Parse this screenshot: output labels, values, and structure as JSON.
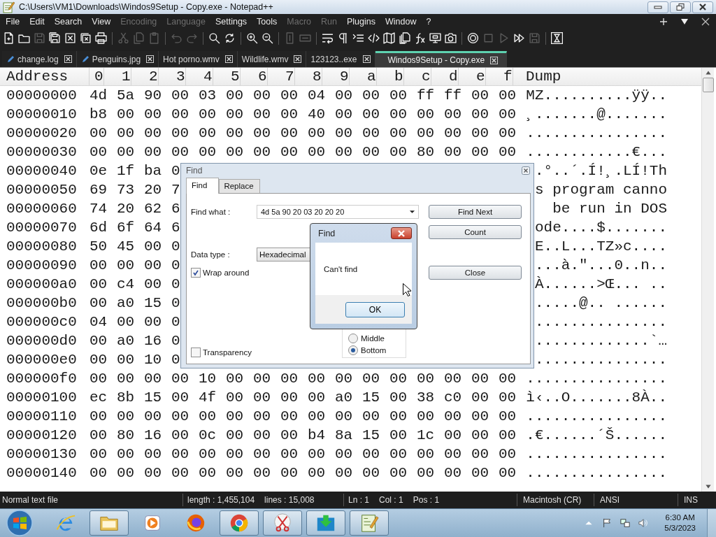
{
  "window": {
    "title": "C:\\Users\\VM1\\Downloads\\Windos9Setup - Copy.exe - Notepad++"
  },
  "menu": [
    {
      "label": "File",
      "disabled": false
    },
    {
      "label": "Edit",
      "disabled": false
    },
    {
      "label": "Search",
      "disabled": false
    },
    {
      "label": "View",
      "disabled": false
    },
    {
      "label": "Encoding",
      "disabled": true
    },
    {
      "label": "Language",
      "disabled": true
    },
    {
      "label": "Settings",
      "disabled": false
    },
    {
      "label": "Tools",
      "disabled": false
    },
    {
      "label": "Macro",
      "disabled": true
    },
    {
      "label": "Run",
      "disabled": true
    },
    {
      "label": "Plugins",
      "disabled": false
    },
    {
      "label": "Window",
      "disabled": false
    },
    {
      "label": "?",
      "disabled": false
    }
  ],
  "toolbar": [
    {
      "kind": "new",
      "disabled": false
    },
    {
      "kind": "open",
      "disabled": false
    },
    {
      "kind": "save",
      "disabled": true
    },
    {
      "kind": "saveall",
      "disabled": false
    },
    {
      "kind": "close",
      "disabled": false
    },
    {
      "kind": "closeall",
      "disabled": false
    },
    {
      "kind": "print",
      "disabled": false
    },
    {
      "kind": "separator"
    },
    {
      "kind": "cut",
      "disabled": true
    },
    {
      "kind": "copy",
      "disabled": true
    },
    {
      "kind": "paste",
      "disabled": true
    },
    {
      "kind": "separator"
    },
    {
      "kind": "undo",
      "disabled": true
    },
    {
      "kind": "redo",
      "disabled": true
    },
    {
      "kind": "separator"
    },
    {
      "kind": "find",
      "disabled": false
    },
    {
      "kind": "replace",
      "disabled": false
    },
    {
      "kind": "separator"
    },
    {
      "kind": "zoomin",
      "disabled": false
    },
    {
      "kind": "zoomout",
      "disabled": false
    },
    {
      "kind": "separator"
    },
    {
      "kind": "syncv",
      "disabled": true
    },
    {
      "kind": "synch",
      "disabled": true
    },
    {
      "kind": "separator"
    },
    {
      "kind": "wrap",
      "disabled": false
    },
    {
      "kind": "allchars",
      "disabled": false
    },
    {
      "kind": "indent",
      "disabled": false
    },
    {
      "kind": "code",
      "disabled": false
    },
    {
      "kind": "map",
      "disabled": false
    },
    {
      "kind": "docs",
      "disabled": false
    },
    {
      "kind": "fx",
      "disabled": false
    },
    {
      "kind": "monitor",
      "disabled": false
    },
    {
      "kind": "snapshot",
      "disabled": false
    },
    {
      "kind": "separator"
    },
    {
      "kind": "record",
      "disabled": false
    },
    {
      "kind": "stop",
      "disabled": true
    },
    {
      "kind": "play",
      "disabled": true
    },
    {
      "kind": "playmulti",
      "disabled": false
    },
    {
      "kind": "saverec",
      "disabled": true
    },
    {
      "kind": "separator"
    },
    {
      "kind": "macro",
      "disabled": false
    }
  ],
  "tabs": [
    {
      "label": "change.log",
      "selected": false,
      "modified": true
    },
    {
      "label": "Penguins.jpg",
      "selected": false,
      "modified": true
    },
    {
      "label": "Hot porno.wmv",
      "selected": false,
      "modified": false
    },
    {
      "label": "Wildlife.wmv",
      "selected": false,
      "modified": false
    },
    {
      "label": "123123..exe",
      "selected": false,
      "modified": false
    },
    {
      "label": "Windos9Setup - Copy.exe",
      "selected": true,
      "modified": false
    }
  ],
  "hex": {
    "header": {
      "address": "Address",
      "columns": [
        "0",
        "1",
        "2",
        "3",
        "4",
        "5",
        "6",
        "7",
        "8",
        "9",
        "a",
        "b",
        "c",
        "d",
        "e",
        "f"
      ],
      "dump": "Dump"
    },
    "rows": [
      {
        "address": "00000000",
        "bytes": [
          "4d",
          "5a",
          "90",
          "00",
          "03",
          "00",
          "00",
          "00",
          "04",
          "00",
          "00",
          "00",
          "ff",
          "ff",
          "00",
          "00"
        ],
        "dump": "MZ..........ÿÿ.."
      },
      {
        "address": "00000010",
        "bytes": [
          "b8",
          "00",
          "00",
          "00",
          "00",
          "00",
          "00",
          "00",
          "40",
          "00",
          "00",
          "00",
          "00",
          "00",
          "00",
          "00"
        ],
        "dump": "¸.......@......."
      },
      {
        "address": "00000020",
        "bytes": [
          "00",
          "00",
          "00",
          "00",
          "00",
          "00",
          "00",
          "00",
          "00",
          "00",
          "00",
          "00",
          "00",
          "00",
          "00",
          "00"
        ],
        "dump": "................"
      },
      {
        "address": "00000030",
        "bytes": [
          "00",
          "00",
          "00",
          "00",
          "00",
          "00",
          "00",
          "00",
          "00",
          "00",
          "00",
          "00",
          "80",
          "00",
          "00",
          "00"
        ],
        "dump": "............€..."
      },
      {
        "address": "00000040",
        "bytes": [
          "0e",
          "1f",
          "ba",
          "0"
        ],
        "dump": ".°..´.Í!¸.LÍ!Th"
      },
      {
        "address": "00000050",
        "bytes": [
          "69",
          "73",
          "20",
          "7"
        ],
        "dump": "s program canno"
      },
      {
        "address": "00000060",
        "bytes": [
          "74",
          "20",
          "62",
          "6"
        ],
        "dump": "be run in DOS"
      },
      {
        "address": "00000070",
        "bytes": [
          "6d",
          "6f",
          "64",
          "6"
        ],
        "dump": "ode....$......."
      },
      {
        "address": "00000080",
        "bytes": [
          "50",
          "45",
          "00",
          "0"
        ],
        "dump": "E..L...TZ»c...."
      },
      {
        "address": "00000090",
        "bytes": [
          "00",
          "00",
          "00",
          "0"
        ],
        "dump": "...à.\"...0..n.."
      },
      {
        "address": "000000a0",
        "bytes": [
          "00",
          "c4",
          "00",
          "0"
        ],
        "dump": "À......>Œ... .."
      },
      {
        "address": "000000b0",
        "bytes": [
          "00",
          "a0",
          "15",
          "0"
        ],
        "dump": ".....@.. ......"
      },
      {
        "address": "000000c0",
        "bytes": [
          "04",
          "00",
          "00",
          "0"
        ],
        "dump": "..............."
      },
      {
        "address": "000000d0",
        "bytes": [
          "00",
          "a0",
          "16",
          "0"
        ],
        "dump": ".............`…"
      },
      {
        "address": "000000e0",
        "bytes": [
          "00",
          "00",
          "10",
          "0"
        ],
        "dump": "..............."
      },
      {
        "address": "000000f0",
        "bytes": [
          "00",
          "00",
          "00",
          "00",
          "10",
          "00",
          "00",
          "00",
          "00",
          "00",
          "00",
          "00",
          "00",
          "00",
          "00",
          "00"
        ],
        "dump": "................"
      },
      {
        "address": "00000100",
        "bytes": [
          "ec",
          "8b",
          "15",
          "00",
          "4f",
          "00",
          "00",
          "00",
          "00",
          "a0",
          "15",
          "00",
          "38",
          "c0",
          "00",
          "00"
        ],
        "dump": "ì‹..O.......8À.."
      },
      {
        "address": "00000110",
        "bytes": [
          "00",
          "00",
          "00",
          "00",
          "00",
          "00",
          "00",
          "00",
          "00",
          "00",
          "00",
          "00",
          "00",
          "00",
          "00",
          "00"
        ],
        "dump": "................"
      },
      {
        "address": "00000120",
        "bytes": [
          "00",
          "80",
          "16",
          "00",
          "0c",
          "00",
          "00",
          "00",
          "b4",
          "8a",
          "15",
          "00",
          "1c",
          "00",
          "00",
          "00"
        ],
        "dump": ".€......´Š......"
      },
      {
        "address": "00000130",
        "bytes": [
          "00",
          "00",
          "00",
          "00",
          "00",
          "00",
          "00",
          "00",
          "00",
          "00",
          "00",
          "00",
          "00",
          "00",
          "00",
          "00"
        ],
        "dump": "................"
      },
      {
        "address": "00000140",
        "bytes": [
          "00",
          "00",
          "00",
          "00",
          "00",
          "00",
          "00",
          "00",
          "00",
          "00",
          "00",
          "00",
          "00",
          "00",
          "00",
          "00"
        ],
        "dump": "................"
      }
    ]
  },
  "find_dialog": {
    "title": "Find",
    "tabs": [
      {
        "label": "Find",
        "selected": true
      },
      {
        "label": "Replace",
        "selected": false
      }
    ],
    "find_what": {
      "label": "Find what :",
      "value": "4d 5a 90 20 03 20 20 20"
    },
    "data_type": {
      "label": "Data type :",
      "value": "Hexadecimal"
    },
    "options": [
      {
        "label": "Wrap around",
        "checked": true
      },
      {
        "label": "Transparency",
        "checked": false
      }
    ],
    "direction": [
      {
        "label": "Middle",
        "selected": false
      },
      {
        "label": "Bottom",
        "selected": true
      }
    ],
    "buttons": [
      "Find Next",
      "Count",
      "Close"
    ]
  },
  "message_box": {
    "title": "Find",
    "message": "Can't find",
    "button": "OK"
  },
  "status_bar": [
    {
      "texts": [
        "Normal text file"
      ]
    },
    {
      "texts": [
        "length : 1,455,104",
        "lines : 15,008"
      ]
    },
    {
      "texts": [
        "Ln : 1",
        "Col : 1",
        "Pos : 1"
      ]
    },
    {
      "texts": [
        "Macintosh (CR)"
      ]
    },
    {
      "texts": [
        "ANSI"
      ]
    },
    {
      "texts": [
        "INS"
      ]
    }
  ],
  "taskbar": {
    "apps": [
      {
        "kind": "browser",
        "running": false
      },
      {
        "kind": "folder",
        "running": true
      },
      {
        "kind": "media",
        "running": false
      },
      {
        "kind": "fox",
        "running": false
      },
      {
        "kind": "chrome",
        "running": true
      },
      {
        "kind": "scissors",
        "running": true
      },
      {
        "kind": "download",
        "running": true
      },
      {
        "kind": "notepad",
        "running": true
      }
    ],
    "clock": {
      "time": "6:30 AM",
      "date": "5/3/2023"
    }
  }
}
